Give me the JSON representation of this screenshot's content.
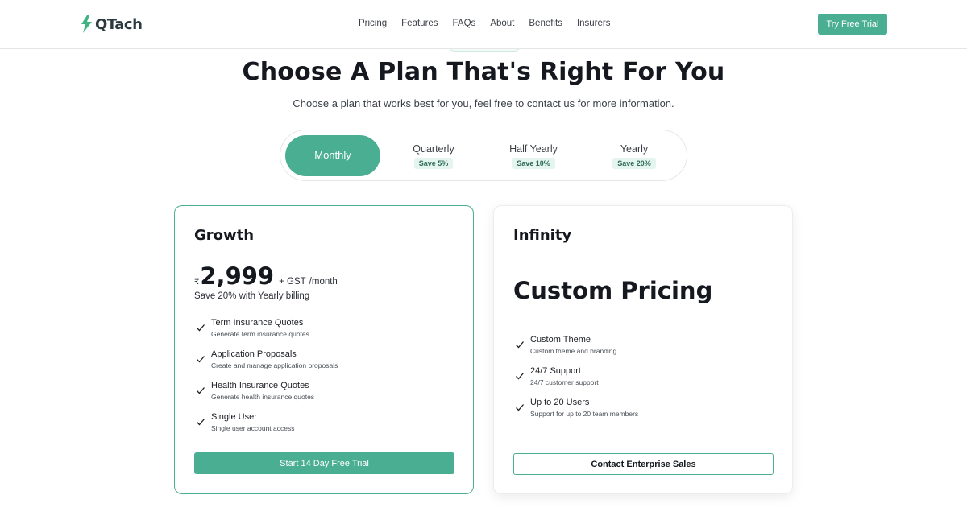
{
  "header": {
    "logo_text": "QTach",
    "nav": [
      "Pricing",
      "Features",
      "FAQs",
      "About",
      "Benefits",
      "Insurers"
    ],
    "cta_label": "Try Free Trial"
  },
  "hero": {
    "title": "Choose A Plan That's Right For You",
    "subtitle": "Choose a plan that works best for you, feel free to contact us for more information."
  },
  "billing": {
    "selected": "Monthly",
    "options": [
      {
        "label": "Monthly",
        "save": ""
      },
      {
        "label": "Quarterly",
        "save": "Save 5%"
      },
      {
        "label": "Half Yearly",
        "save": "Save 10%"
      },
      {
        "label": "Yearly",
        "save": "Save 20%"
      }
    ]
  },
  "plans": [
    {
      "name": "Growth",
      "currency": "₹",
      "price": "2,999",
      "gst": "+ GST",
      "period": "/month",
      "note": "Save 20% with Yearly billing",
      "features": [
        {
          "title": "Term Insurance Quotes",
          "desc": "Generate term insurance quotes"
        },
        {
          "title": "Application Proposals",
          "desc": "Create and manage application proposals"
        },
        {
          "title": "Health Insurance Quotes",
          "desc": "Generate health insurance quotes"
        },
        {
          "title": "Single User",
          "desc": "Single user account access"
        }
      ],
      "cta": "Start 14 Day Free Trial"
    },
    {
      "name": "Infinity",
      "price_text": "Custom Pricing",
      "features": [
        {
          "title": "Custom Theme",
          "desc": "Custom theme and branding"
        },
        {
          "title": "24/7 Support",
          "desc": "24/7 customer support"
        },
        {
          "title": "Up to 20 Users",
          "desc": "Support for up to 20 team members"
        }
      ],
      "cta": "Contact Enterprise Sales"
    }
  ],
  "colors": {
    "accent": "#4aae92",
    "logo_green": "#3fb27f",
    "text": "#15191f"
  }
}
